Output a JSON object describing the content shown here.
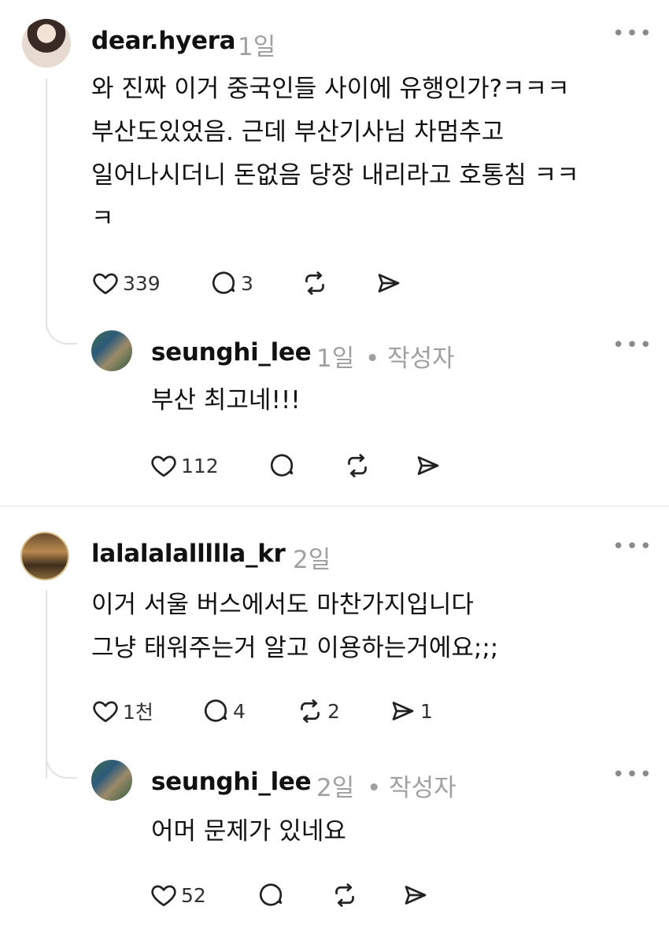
{
  "comments": [
    {
      "username": "dear.hyera",
      "time": "1일",
      "text": "와 진짜 이거 중국인들 사이에 유행인가?ㅋㅋㅋ\n부산도있었음. 근데 부산기사님 차멈추고\n일어나시더니 돈없음 당장 내리라고 호통침 ㅋㅋ\nㅋ",
      "likes": "339",
      "replies": "3",
      "reposts": "",
      "shares": "",
      "reply": {
        "username": "seunghi_lee",
        "time": "1일",
        "author_tag": "• 작성자",
        "text": "부산 최고네!!!",
        "likes": "112"
      }
    },
    {
      "username": "lalalalallllla_kr",
      "time": "2일",
      "text": "이거 서울 버스에서도 마찬가지입니다\n그냥 태워주는거 알고 이용하는거에요;;;",
      "likes": "1천",
      "replies": "4",
      "reposts": "2",
      "shares": "1",
      "reply": {
        "username": "seunghi_lee",
        "time": "2일",
        "author_tag": "• 작성자",
        "text": "어머 문제가 있네요",
        "likes": "52"
      }
    }
  ],
  "more_icon": "•••",
  "icons": {
    "like": "heart-icon",
    "reply": "speech-bubble-icon",
    "repost": "repost-icon",
    "share": "send-icon"
  }
}
